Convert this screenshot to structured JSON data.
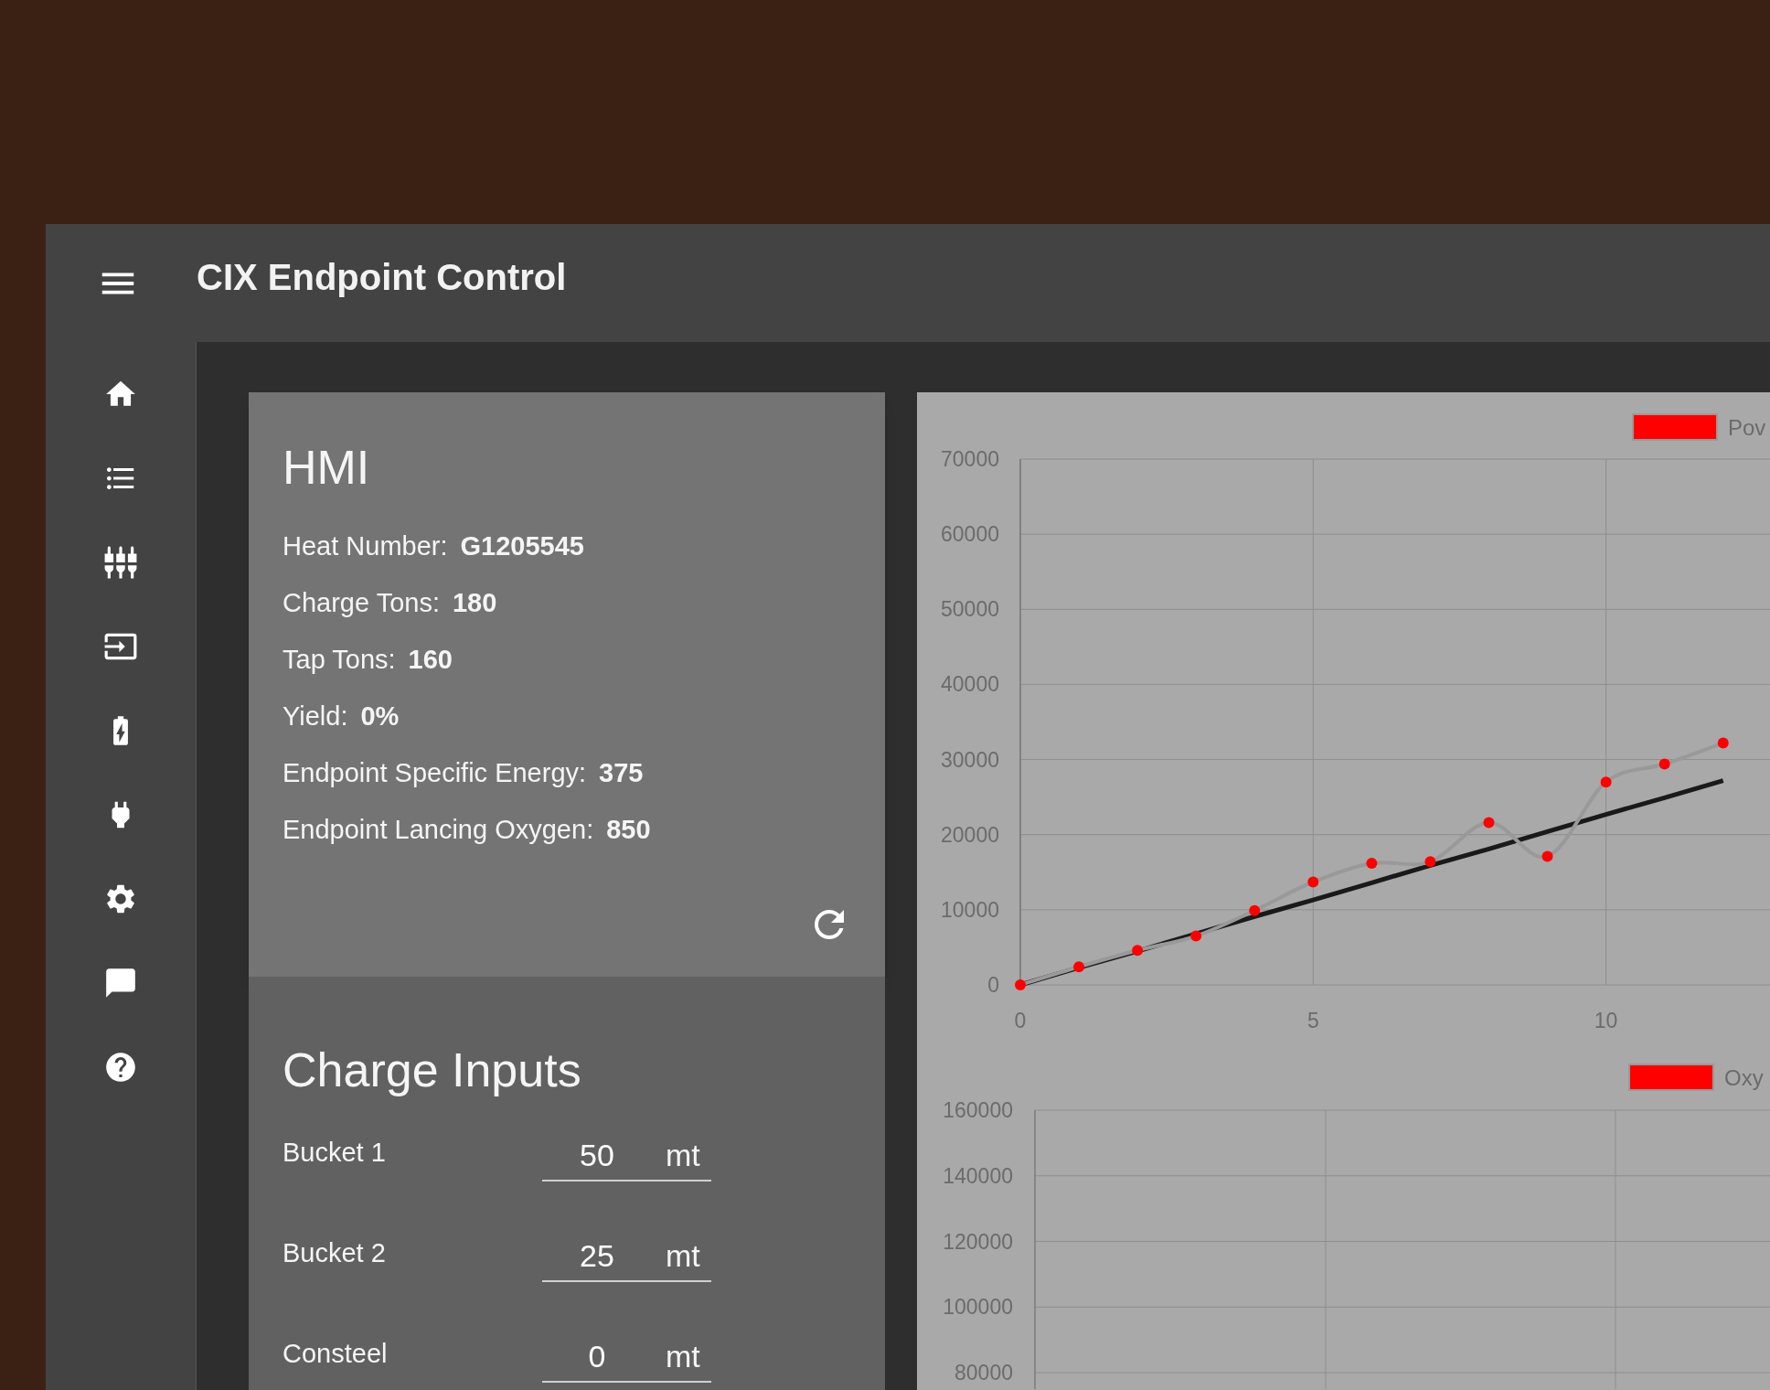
{
  "app": {
    "title": "CIX Endpoint Control"
  },
  "hmi": {
    "title": "HMI",
    "fields": [
      {
        "label": "Heat Number:",
        "value": "G1205545"
      },
      {
        "label": "Charge Tons:",
        "value": "180"
      },
      {
        "label": "Tap Tons:",
        "value": "160"
      },
      {
        "label": "Yield:",
        "value": "0%"
      },
      {
        "label": "Endpoint Specific Energy:",
        "value": "375"
      },
      {
        "label": "Endpoint Lancing Oxygen:",
        "value": "850"
      }
    ]
  },
  "charge_inputs": {
    "title": "Charge Inputs",
    "rows": [
      {
        "label": "Bucket 1",
        "value": "50",
        "unit": "mt"
      },
      {
        "label": "Bucket 2",
        "value": "25",
        "unit": "mt"
      },
      {
        "label": "Consteel",
        "value": "0",
        "unit": "mt"
      }
    ]
  },
  "charts": [
    {
      "chart_data": {
        "type": "line",
        "grid": true,
        "x": [
          0,
          1,
          2,
          3,
          4,
          5,
          6,
          7,
          8,
          9,
          10,
          11,
          12
        ],
        "xlim": [
          0,
          12.8
        ],
        "xticks": [
          0,
          5,
          10
        ],
        "yticks": [
          0,
          10000,
          20000,
          30000,
          40000,
          50000,
          60000,
          70000
        ],
        "ylim": [
          0,
          70000
        ],
        "series": [
          {
            "name": "Pov",
            "color": "#ff0000",
            "marker": "circle",
            "values": [
              0,
              2400,
              4600,
              6500,
              9900,
              13700,
              16200,
              16400,
              21600,
              17100,
              27000,
              29400,
              32200
            ]
          },
          {
            "color": "#1a1a1a",
            "values": [
              0,
              2300,
              4500,
              6800,
              9100,
              11300,
              13600,
              15900,
              18100,
              20400,
              22700,
              24900,
              27200
            ]
          }
        ]
      }
    },
    {
      "chart_data": {
        "type": "line",
        "grid": true,
        "ylim": [
          75000,
          160000
        ],
        "yticks": [
          80000,
          100000,
          120000,
          140000,
          160000
        ],
        "series": [
          {
            "name": "Oxy",
            "color": "#ff0000"
          }
        ]
      }
    }
  ]
}
